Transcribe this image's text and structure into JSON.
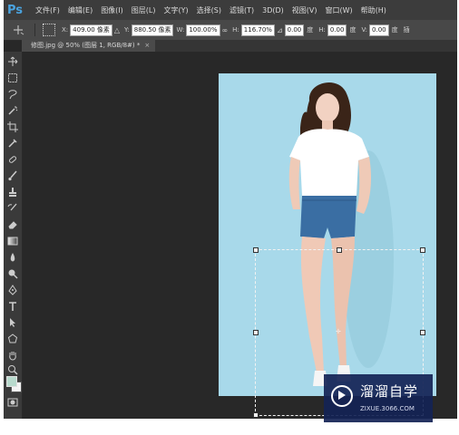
{
  "app": {
    "logo": "Ps",
    "menu": [
      "文件(F)",
      "编辑(E)",
      "图像(I)",
      "图层(L)",
      "文字(Y)",
      "选择(S)",
      "滤镜(T)",
      "3D(D)",
      "视图(V)",
      "窗口(W)",
      "帮助(H)"
    ]
  },
  "options": {
    "x_label": "X:",
    "x_value": "409.00 像素",
    "delta_glyph": "△",
    "y_label": "Y:",
    "y_value": "880.50 像素",
    "w_label": "W:",
    "w_value": "100.00%",
    "link_glyph": "∞",
    "h_label": "H:",
    "h_value": "116.70%",
    "angle_glyph": "⊿",
    "angle_value": "0.00",
    "angle_unit": "度",
    "hskew_label": "H:",
    "hskew_value": "0.00",
    "hskew_unit": "度",
    "vskew_label": "V:",
    "vskew_value": "0.00",
    "vskew_unit": "度",
    "interp": "插"
  },
  "document": {
    "tab_title": "修图.jpg @ 50% (图层 1, RGB/8#) *",
    "tab_close": "×"
  },
  "tools": [
    "move-tool-icon",
    "marquee-tool-icon",
    "lasso-tool-icon",
    "magic-wand-icon",
    "crop-tool-icon",
    "eyedropper-icon",
    "healing-brush-icon",
    "brush-tool-icon",
    "clone-stamp-icon",
    "history-brush-icon",
    "eraser-icon",
    "gradient-icon",
    "blur-icon",
    "dodge-icon",
    "pen-tool-icon",
    "type-tool-icon",
    "path-select-icon",
    "shape-tool-icon",
    "hand-tool-icon",
    "zoom-tool-icon"
  ],
  "colors": {
    "foreground": "#b7d9cc",
    "background": "#f4f4f4",
    "canvas_bg": "#a8d9ea"
  },
  "watermark": {
    "title": "溜溜自学",
    "url": "ZIXUE.3066.COM"
  }
}
